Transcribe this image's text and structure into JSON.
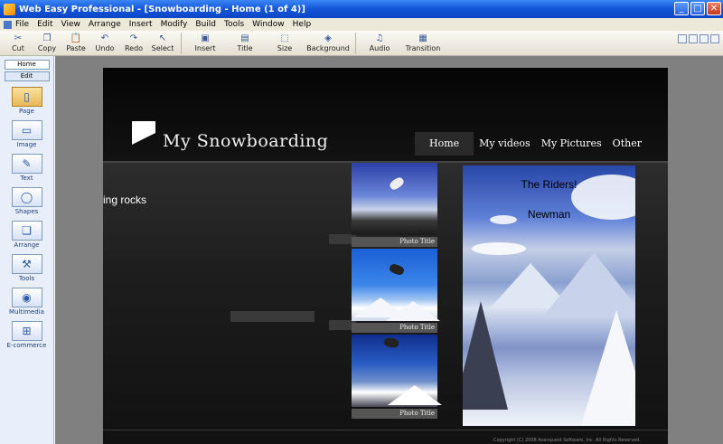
{
  "window": {
    "title": "Web Easy Professional - [Snowboarding - Home (1 of 4)]"
  },
  "menu": [
    "File",
    "Edit",
    "View",
    "Arrange",
    "Insert",
    "Modify",
    "Build",
    "Tools",
    "Window",
    "Help"
  ],
  "toolbar": {
    "cut": "Cut",
    "copy": "Copy",
    "paste": "Paste",
    "undo": "Undo",
    "redo": "Redo",
    "select": "Select",
    "insert": "Insert",
    "title": "Title",
    "size": "Size",
    "background": "Background",
    "audio": "Audio",
    "transition": "Transition"
  },
  "left_panel": {
    "tabs": [
      "Home",
      "Edit"
    ],
    "items": [
      "Page",
      "Image",
      "Text",
      "Shapes",
      "Arrange",
      "Tools",
      "Multimedia",
      "E-commerce"
    ]
  },
  "site": {
    "title": "My Snowboarding",
    "nav": [
      "Home",
      "My videos",
      "My Pictures",
      "Other"
    ],
    "scroll_text": "ing rocks",
    "photo_title": "Photo Title",
    "riders_title": "The Riders!",
    "rider_name": "Newman",
    "footer": "Copyright (C) 2008 Avanquest Software, Inc. All Rights Reserved."
  }
}
